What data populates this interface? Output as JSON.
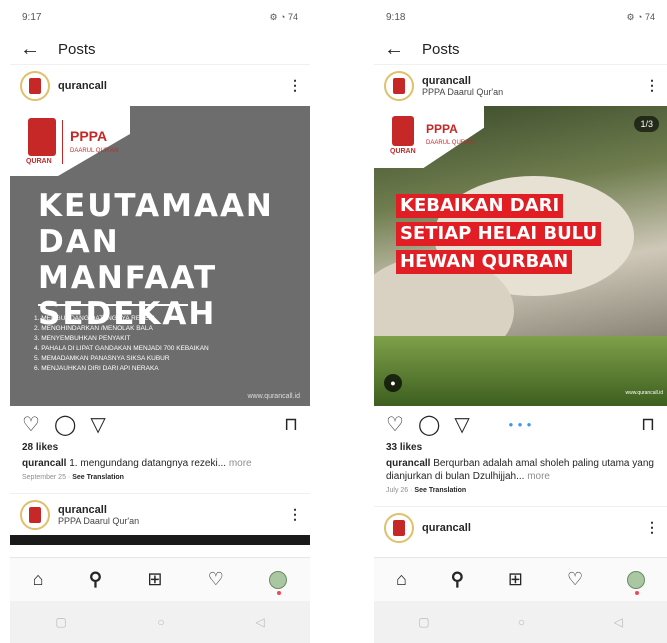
{
  "left": {
    "status_time": "9:17",
    "status_right": "⚙ ◔ 74",
    "topbar_title": "Posts",
    "post_user": "qurancall",
    "image": {
      "logo_text": "QURAN",
      "pppa_logo": "PPPA",
      "pppa_sub": "DAARUL QUR'AN",
      "headline": [
        "KEUTAMAAN",
        "DAN MANFAAT",
        "SEDEKAH"
      ],
      "list": [
        "1. MENGUNDANG DATANGNYA REZEKI",
        "2. MENGHINDARKAN /MENOLAK BALA",
        "3. MENYEMBUHKAN PENYAKIT",
        "4. PAHALA  DI LIPAT GANDAKAN MENJADI 700 KEBAIKAN",
        "5. MEMADAMKAN PANASNYA SIKSA KUBUR",
        "6. MENJAUHKAN DIRI DARI API NERAKA"
      ],
      "website": "www.qurancall.id"
    },
    "likes": "28 likes",
    "caption_user": "qurancall",
    "caption_text": "1. mengundang datangnya rezeki...",
    "caption_more": "more",
    "date": "September 25",
    "see_translation": "See Translation",
    "next_post_user": "qurancall",
    "next_post_sub": "PPPA Daarul Qur'an"
  },
  "right": {
    "status_time": "9:18",
    "status_right": "⚙ ◔ 74",
    "topbar_title": "Posts",
    "post_user": "qurancall",
    "post_sub": "PPPA Daarul Qur'an",
    "image": {
      "counter": "1/3",
      "logo_text": "QURAN",
      "pppa_logo": "PPPA",
      "pppa_sub": "DAARUL QUR'AN",
      "banner": [
        "KEBAIKAN DARI",
        "SETIAP HELAI BULU",
        "HEWAN QURBAN"
      ],
      "footer": "www.qurancall.id"
    },
    "likes": "33 likes",
    "caption_user": "qurancall",
    "caption_text": "Berqurban adalah amal sholeh paling utama yang dianjurkan di bulan Dzulhijjah...",
    "caption_more": "more",
    "date": "July 26",
    "see_translation": "See Translation",
    "next_post_user": "qurancall"
  },
  "icons": {
    "back": "←",
    "more": "⋮",
    "heart": "♡",
    "comment": "◯",
    "share": "▽",
    "bookmark": "⊓",
    "home": "⌂",
    "search": "⚲",
    "add": "⊞",
    "sys_square": "▢",
    "sys_circle": "○",
    "sys_back": "◁"
  },
  "colors": {
    "accent_red": "#e01e24",
    "brand_red": "#c62828",
    "link_blue": "#3897f0"
  }
}
